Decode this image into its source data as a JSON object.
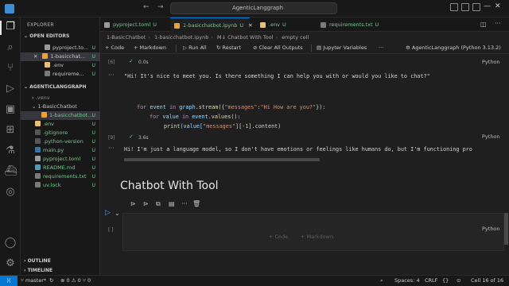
{
  "titlebar": {
    "search_text": "AgenticLanggraph",
    "nav_back": "←",
    "nav_forward": "→"
  },
  "sidebar": {
    "explorer_title": "EXPLORER",
    "open_editors_label": "OPEN EDITORS",
    "open_editors": [
      {
        "name": "pyproject.to...",
        "badge": "U"
      },
      {
        "name": "1-basicchat...",
        "badge": "U",
        "prefix": "✕"
      },
      {
        "name": ".env",
        "badge": "U"
      },
      {
        "name": "requireme...",
        "badge": "U"
      }
    ],
    "project_label": "AGENTICLANGGRAPH",
    "tree": [
      {
        "name": ".venv",
        "badge": ""
      },
      {
        "name": "1-BasicChatbot",
        "badge": ""
      },
      {
        "name": "1-basicchatbot....",
        "badge": "U"
      },
      {
        "name": ".env",
        "badge": "U"
      },
      {
        "name": ".gitignore",
        "badge": "U"
      },
      {
        "name": ".python-version",
        "badge": "U"
      },
      {
        "name": "main.py",
        "badge": "U"
      },
      {
        "name": "pyproject.toml",
        "badge": "U"
      },
      {
        "name": "README.md",
        "badge": "U"
      },
      {
        "name": "requirements.txt",
        "badge": "U"
      },
      {
        "name": "uv.lock",
        "badge": "U"
      }
    ],
    "outline_label": "OUTLINE",
    "timeline_label": "TIMELINE"
  },
  "tabs": [
    {
      "label": "pyproject.toml",
      "badge": "U"
    },
    {
      "label": "1-basicchatbot.ipynb",
      "badge": "U"
    },
    {
      "label": ".env",
      "badge": "U"
    },
    {
      "label": "requirements.txt",
      "badge": "U"
    }
  ],
  "breadcrumb": [
    "1-BasicChatbot",
    "1-basicchatbot.ipynb",
    "M↓ Chatbot With Tool",
    "empty cell"
  ],
  "nb_toolbar": {
    "code": "+ Code",
    "markdown": "+ Markdown",
    "run_all": "Run All",
    "restart": "Restart",
    "clear_outputs": "Clear All Outputs",
    "variables": "Jupyter Variables",
    "more": "···",
    "kernel": "AgenticLanggraph (Python 3.13.2)"
  },
  "cells": {
    "cell1_count": "[6]",
    "cell1_time": "0.0s",
    "cell1_output": "\"Hi! It's nice to meet you. Is there something I can help you with or would you like to chat?\"",
    "cell2_count": "[9]",
    "cell2_time": "3.6s",
    "cell2_lang": "Python",
    "cell2_output": "Hi! I'm just a language model, so I don't have emotions or feelings like humans do, but I'm functioning pro",
    "cell1_lang": "Python",
    "markdown_heading": "Chatbot With Tool",
    "empty_count": "[ ]",
    "empty_lang": "Python",
    "add_code": "+ Code",
    "add_markdown": "+ Markdown"
  },
  "code": {
    "line1_kw": "for",
    "line1_a": " event ",
    "line1_in": "in",
    "line1_b": " graph.",
    "line1_fn": "stream",
    "line1_c": "({",
    "line1_s1": "\"messages\"",
    "line1_d": ":",
    "line1_s2": "\"Hi How are you?\"",
    "line1_e": "}):",
    "line2_kw": "for",
    "line2_a": " value ",
    "line2_in": "in",
    "line2_b": " event.",
    "line2_fn": "values",
    "line2_c": "():",
    "line3_fn": "print",
    "line3_a": "(value[",
    "line3_s": "\"messages\"",
    "line3_b": "][",
    "line3_n": "-1",
    "line3_c": "].content)"
  },
  "statusbar": {
    "branch": "master*",
    "errors": "⊗ 0 ⚠ 0",
    "ports": "⑂ 0",
    "spaces": "Spaces: 4",
    "eol": "CRLF",
    "cell": "Cell 16 of 16"
  },
  "colors": {
    "accent": "#0078d4",
    "untracked": "#73c991"
  }
}
